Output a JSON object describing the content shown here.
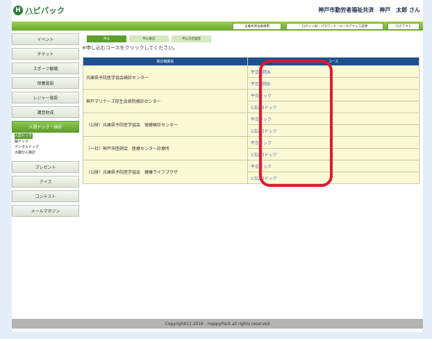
{
  "logo": {
    "mark": "H",
    "text": "ハピパック",
    "sub": "HAPPYPACK"
  },
  "header": {
    "user_text": "神戸市勤労者福祉共済　神戸　太郎 さん"
  },
  "topnav": {
    "buttons": [
      "企業共済会員専用",
      "ログインID・パスワード・メールアドレス変更",
      "ログアウト"
    ]
  },
  "sidebar": {
    "items": [
      {
        "label": "イベント"
      },
      {
        "label": "チケット"
      },
      {
        "label": "スポーツ観戦"
      },
      {
        "label": "保養施設"
      },
      {
        "label": "レジャー施設"
      },
      {
        "label": "講習助成"
      },
      {
        "label": "人間ドック・検診"
      }
    ],
    "subitems": [
      {
        "label": "人間ドック"
      },
      {
        "label": "脳ドック"
      },
      {
        "label": "デンタルドック"
      },
      {
        "label": "大腸がん検診"
      }
    ],
    "items_bottom": [
      {
        "label": "プレゼント"
      },
      {
        "label": "クイズ"
      },
      {
        "label": "コンテスト"
      },
      {
        "label": "メールマガジン"
      }
    ]
  },
  "tabs": [
    "申込",
    "申込確認",
    "申込決定履歴"
  ],
  "instruction": "※申し込むコースをクリックしてください。",
  "table": {
    "headers": [
      "検診機関名",
      "コース"
    ],
    "rows": [
      {
        "org": "兵庫県予防医学協会検診センター",
        "courses": [
          "平日通院A",
          "平日通院B"
        ]
      },
      {
        "org": "神戸マリナーズ厚生会病院検診センター",
        "courses": [
          "平日ドック",
          "1泊2日ドック"
        ]
      },
      {
        "org": "（公財）兵庫県予防医学協会　保健検診センター",
        "courses": [
          "平日ドック",
          "1泊2日ドック"
        ]
      },
      {
        "org": "（一社）神戸市医師会　医療センター診療所",
        "courses": [
          "平日ドック",
          "1泊2日ドック"
        ]
      },
      {
        "org": "（公財）兵庫県予防医学協会　健康ライフプラザ",
        "courses": [
          "平日ドック",
          "1泊2日ドック"
        ]
      }
    ]
  },
  "footer": "Copyright(C) 2016 - HappyPack all rights reserved",
  "colors": {
    "accent_green": "#5e9e2c",
    "table_header": "#1e4f8e",
    "highlight": "#e21830"
  }
}
